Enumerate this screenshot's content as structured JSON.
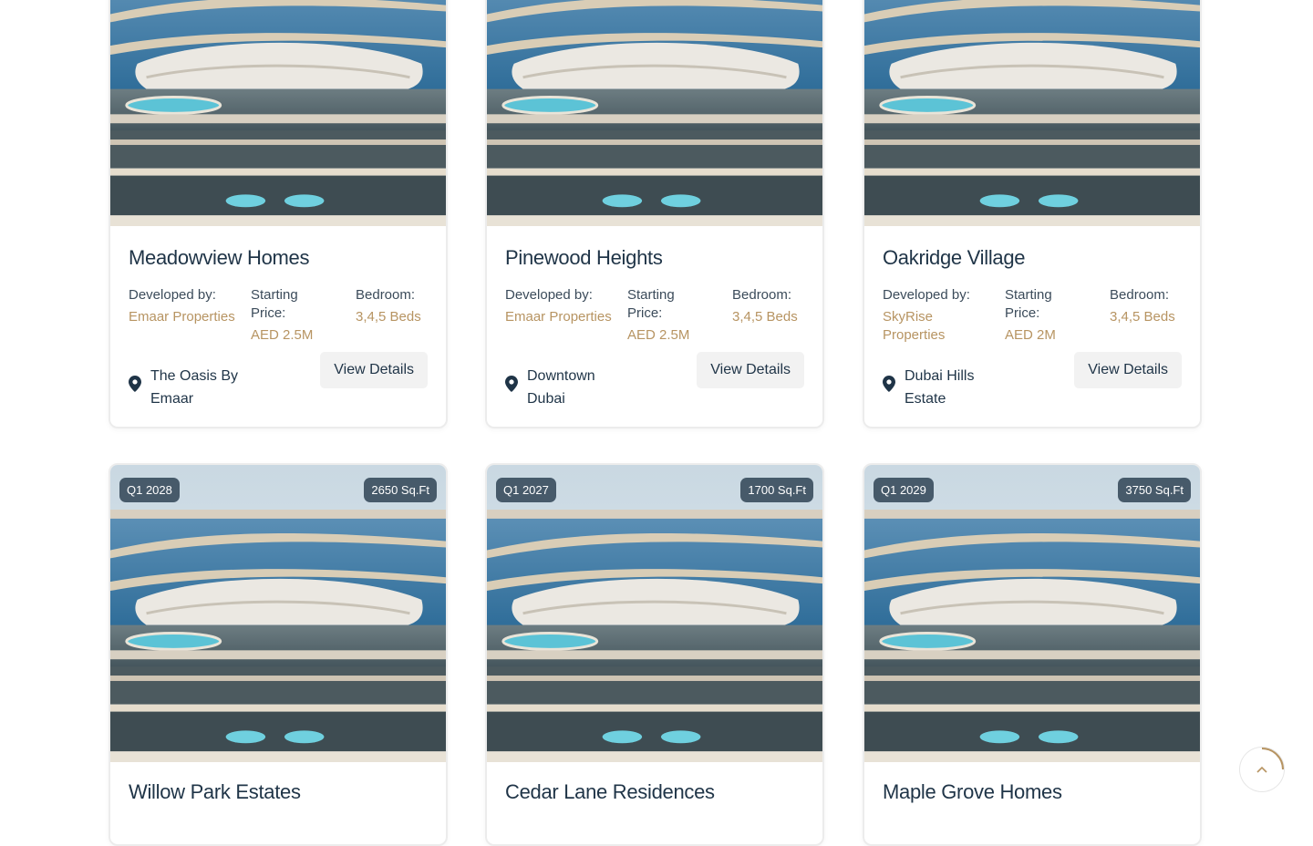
{
  "cards_top": [
    {
      "title": "Meadowview Homes",
      "developer_label": "Developed by:",
      "developer": "Emaar Properties",
      "price_label": "Starting Price:",
      "price": "AED 2.5M",
      "bedroom_label": "Bedroom:",
      "bedrooms": "3,4,5 Beds",
      "location": "The Oasis By Emaar",
      "button": "View Details"
    },
    {
      "title": "Pinewood Heights",
      "developer_label": "Developed by:",
      "developer": "Emaar Properties",
      "price_label": "Starting Price:",
      "price": "AED 2.5M",
      "bedroom_label": "Bedroom:",
      "bedrooms": "3,4,5 Beds",
      "location": "Downtown Dubai",
      "button": "View Details"
    },
    {
      "title": "Oakridge Village",
      "developer_label": "Developed by:",
      "developer": "SkyRise Properties",
      "price_label": "Starting Price:",
      "price": "AED 2M",
      "bedroom_label": "Bedroom:",
      "bedrooms": "3,4,5 Beds",
      "location": "Dubai Hills Estate",
      "button": "View Details"
    }
  ],
  "cards_bottom": [
    {
      "title": "Willow Park Estates",
      "handover": "Q1 2028",
      "area": "2650 Sq.Ft"
    },
    {
      "title": "Cedar Lane Residences",
      "handover": "Q1 2027",
      "area": "1700 Sq.Ft"
    },
    {
      "title": "Maple Grove Homes",
      "handover": "Q1 2029",
      "area": "3750 Sq.Ft"
    }
  ],
  "colors": {
    "accent": "#b79462",
    "title": "#1f3447",
    "badge_bg": "#14283c"
  },
  "icons": {
    "location": "map-pin-icon",
    "scroll_top": "chevron-up-icon"
  }
}
